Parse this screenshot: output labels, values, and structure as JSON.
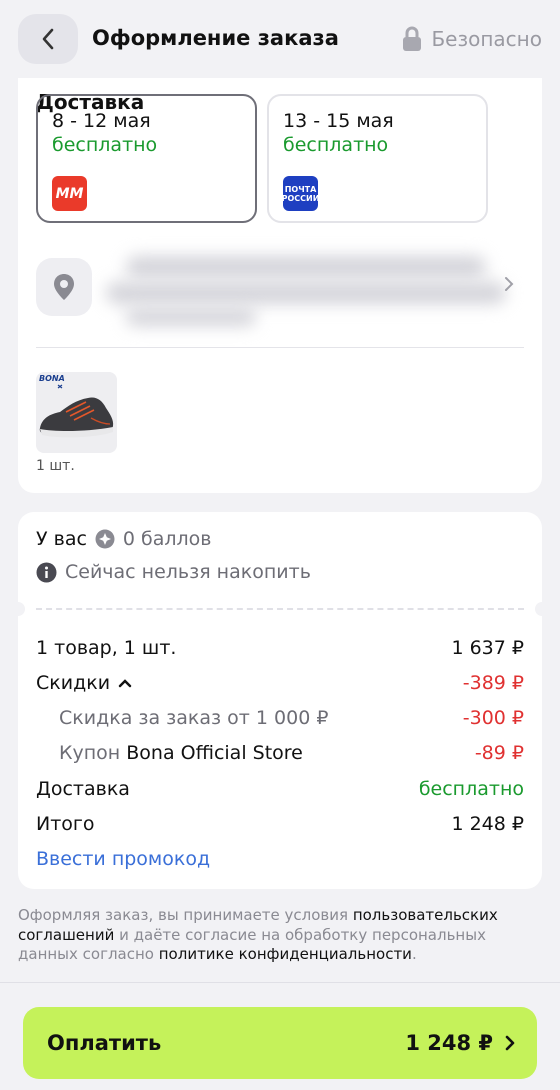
{
  "header": {
    "title": "Оформление заказа",
    "secure_label": "Безопасно"
  },
  "delivery": {
    "heading": "Доставка",
    "options": [
      {
        "dates": "8 - 12 мая",
        "price": "бесплатно",
        "carrier_logo_text": "MM",
        "selected": true
      },
      {
        "dates": "13 - 15 мая",
        "price": "бесплатно",
        "carrier_logo_text": "ПОЧТА РОССИИ",
        "selected": false
      }
    ]
  },
  "product": {
    "brand": "BONA",
    "quantity": "1 шт."
  },
  "points": {
    "label": "У вас",
    "value": "0 баллов",
    "note": "Сейчас нельзя накопить"
  },
  "summary": {
    "items_label": "1 товар, 1 шт.",
    "items_value": "1 637 ₽",
    "discounts_label": "Скидки",
    "discounts_value": "-389 ₽",
    "discount_order_label": "Скидка за заказ от 1 000 ₽",
    "discount_order_value": "-300 ₽",
    "coupon_prefix": "Купон",
    "coupon_name": "Bona Official Store",
    "coupon_value": "-89 ₽",
    "delivery_label": "Доставка",
    "delivery_value": "бесплатно",
    "total_label": "Итого",
    "total_value": "1 248 ₽",
    "promo_link": "Ввести промокод"
  },
  "legal": {
    "t1": "Оформляя заказ, вы принимаете условия ",
    "l1": "пользовательских соглашений",
    "t2": " и даёте согласие на обработку персональных данных согласно ",
    "l2": "политике конфиденциальности",
    "t3": "."
  },
  "footer": {
    "pay_label": "Оплатить",
    "pay_amount": "1 248 ₽"
  },
  "colors": {
    "accent_button": "#c5f25a",
    "free_green": "#1a9a2e",
    "discount_red": "#e03131",
    "link_blue": "#3a6fd8"
  }
}
